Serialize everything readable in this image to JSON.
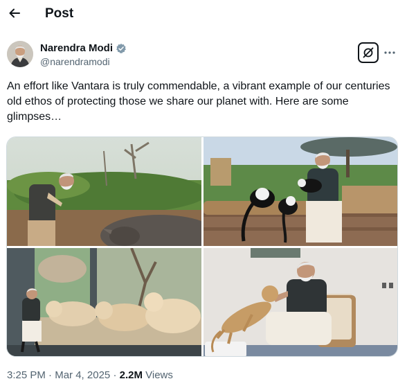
{
  "header": {
    "title": "Post",
    "back_icon": "arrow-left-icon"
  },
  "author": {
    "name": "Narendra Modi",
    "handle": "@narendramodi",
    "verified": true,
    "verified_color": "#829aab"
  },
  "tweet": {
    "text": "An effort like Vantara is truly commendable, a vibrant example of our centuries old ethos of protecting those we share our planet with. Here are some glimpses…"
  },
  "media": {
    "count": 4
  },
  "meta": {
    "time": "3:25 PM",
    "separator": "·",
    "date": "Mar 4, 2025",
    "views_count": "2.2M",
    "views_label": "Views"
  },
  "actions": {
    "grok_icon": "grok-icon",
    "more_icon": "more-options-icon"
  },
  "colors": {
    "text": "#0f1419",
    "secondary": "#536471",
    "border": "#cfd9de"
  }
}
